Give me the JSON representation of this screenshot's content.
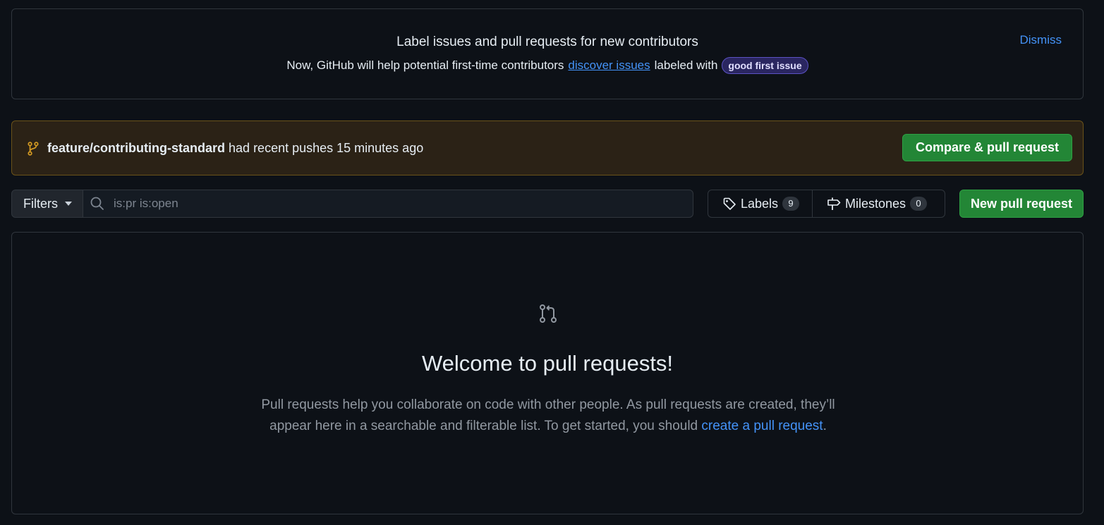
{
  "banner": {
    "title": "Label issues and pull requests for new contributors",
    "desc_before": "Now, GitHub will help potential first-time contributors",
    "desc_link": "discover issues",
    "desc_after": "labeled with",
    "label": "good first issue",
    "dismiss": "Dismiss"
  },
  "pushes": {
    "branch": "feature/contributing-standard",
    "message": "had recent pushes 15 minutes ago",
    "compare_button": "Compare & pull request"
  },
  "toolbar": {
    "filters_label": "Filters",
    "search_value": "",
    "search_placeholder": "is:pr is:open",
    "labels_label": "Labels",
    "labels_count": "9",
    "milestones_label": "Milestones",
    "milestones_count": "0",
    "new_pr_button": "New pull request"
  },
  "blankslate": {
    "title": "Welcome to pull requests!",
    "desc_line1": "Pull requests help you collaborate on code with other people. As pull requests are created, they’ll",
    "desc_line2_before": "appear here in a searchable and filterable list. To get started, you should",
    "desc_link": "create a pull request",
    "desc_end": "."
  },
  "icons": {
    "branch": "git-branch-icon",
    "search": "search-icon",
    "tag": "tag-icon",
    "milestone": "milestone-icon",
    "pull_request": "git-pull-request-icon"
  },
  "colors": {
    "background": "#0d1117",
    "border": "#30363d",
    "accent_link": "#4493f8",
    "primary_button": "#238636",
    "push_banner_bg": "#2b2216",
    "push_banner_border": "#6a5219",
    "branch_icon": "#d29922"
  }
}
